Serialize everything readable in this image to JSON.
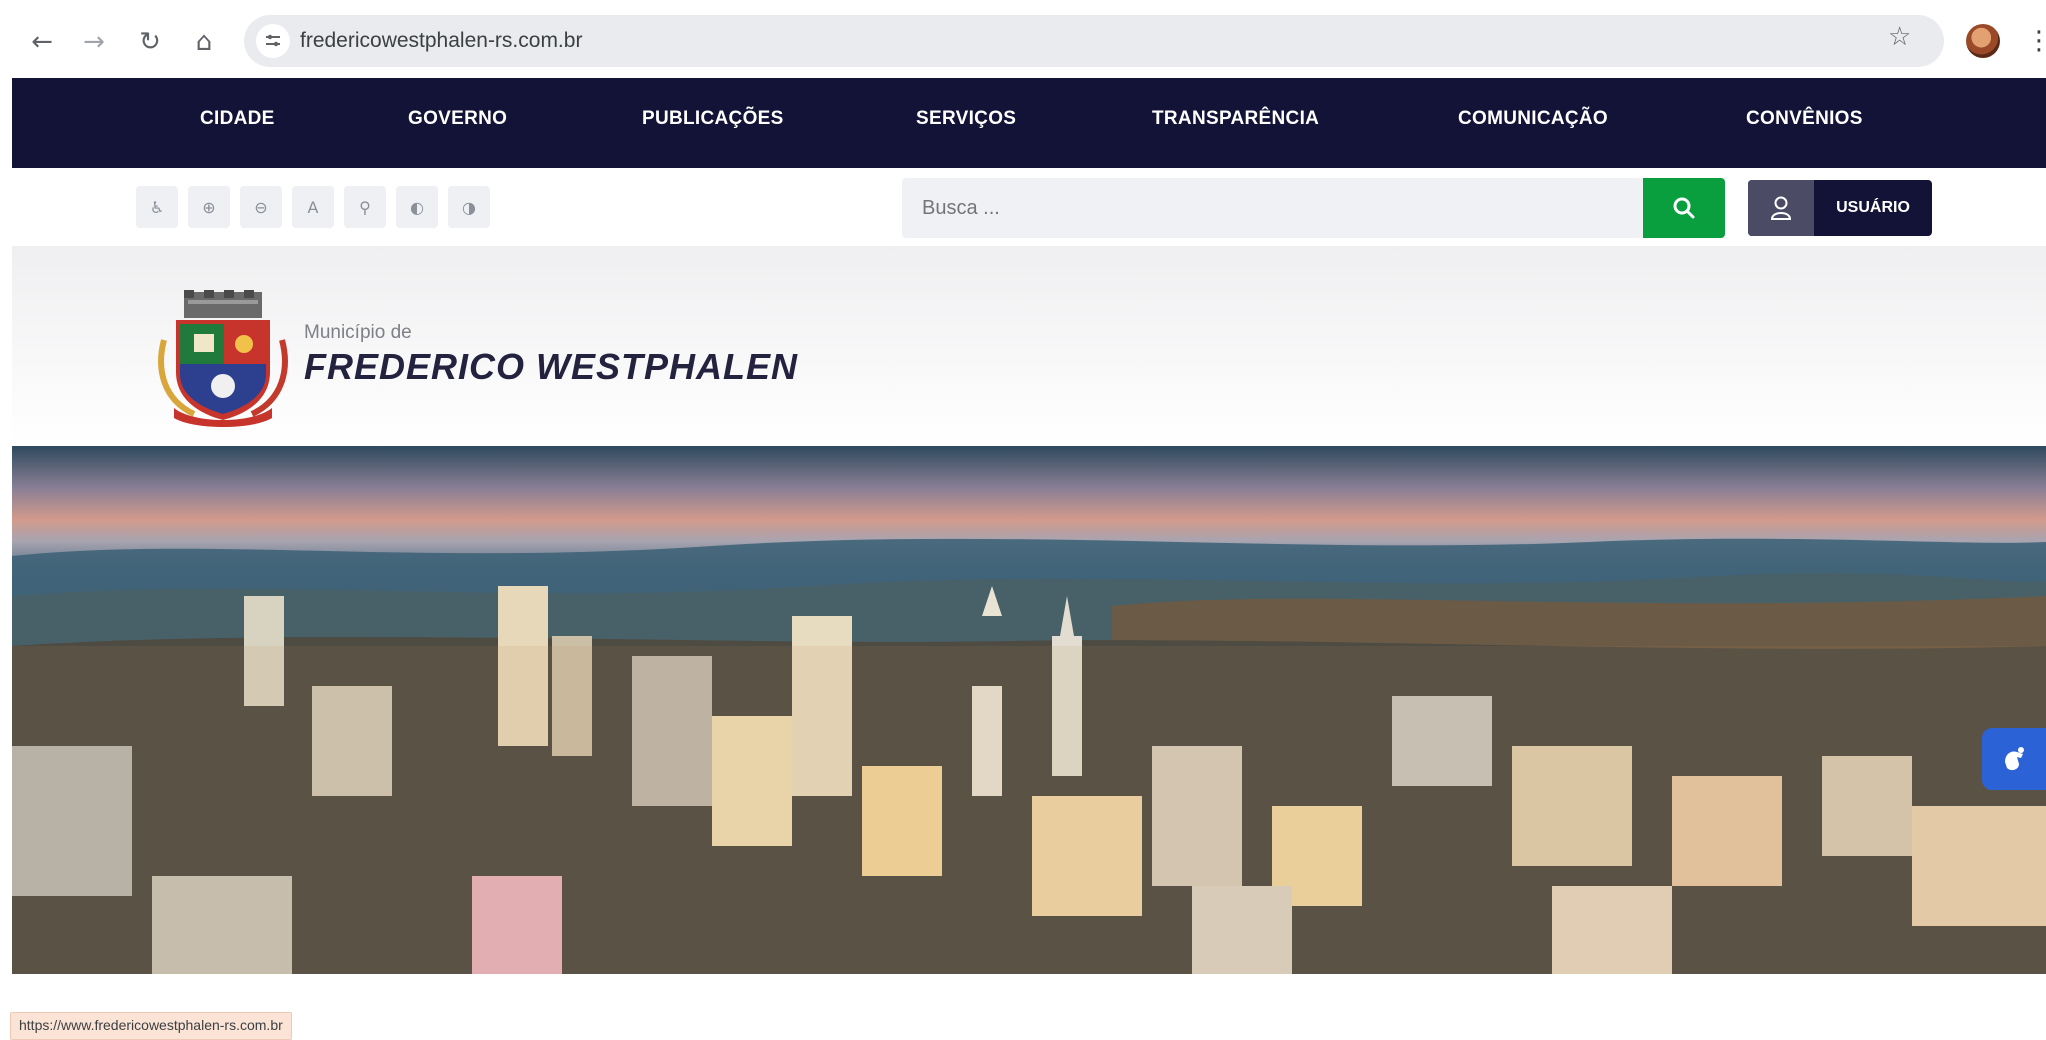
{
  "browser": {
    "url": "fredericowestphalen-rs.com.br",
    "back_icon": "arrow-left-icon",
    "forward_icon": "arrow-right-icon",
    "reload_icon": "reload-icon",
    "home_icon": "home-icon",
    "bookmark_icon": "star-icon",
    "menu_icon": "kebab-icon",
    "status_url": "https://www.fredericowestphalen-rs.com.br"
  },
  "nav": {
    "items": [
      {
        "label": "CIDADE"
      },
      {
        "label": "GOVERNO"
      },
      {
        "label": "PUBLICAÇÕES"
      },
      {
        "label": "SERVIÇOS"
      },
      {
        "label": "TRANSPARÊNCIA"
      },
      {
        "label": "COMUNICAÇÃO"
      },
      {
        "label": "CONVÊNIOS"
      }
    ]
  },
  "toolbar": {
    "accessibility": [
      {
        "icon": "accessibility-icon",
        "glyph": "♿"
      },
      {
        "icon": "increase-font-icon",
        "glyph": "⊕"
      },
      {
        "icon": "decrease-font-icon",
        "glyph": "⊖"
      },
      {
        "icon": "font-size-icon",
        "glyph": "A"
      },
      {
        "icon": "location-icon",
        "glyph": "⚲"
      },
      {
        "icon": "contrast-icon",
        "glyph": "◐"
      },
      {
        "icon": "contrast-alt-icon",
        "glyph": "◑"
      }
    ],
    "search_placeholder": "Busca ...",
    "user_label": "USUÁRIO"
  },
  "header": {
    "municipio_label": "Município de",
    "municipio_name": "FREDERICO WESTPHALEN"
  },
  "colors": {
    "nav_bg": "#131338",
    "search_button": "#0a9f3e",
    "assist_button": "#2b63d6"
  }
}
